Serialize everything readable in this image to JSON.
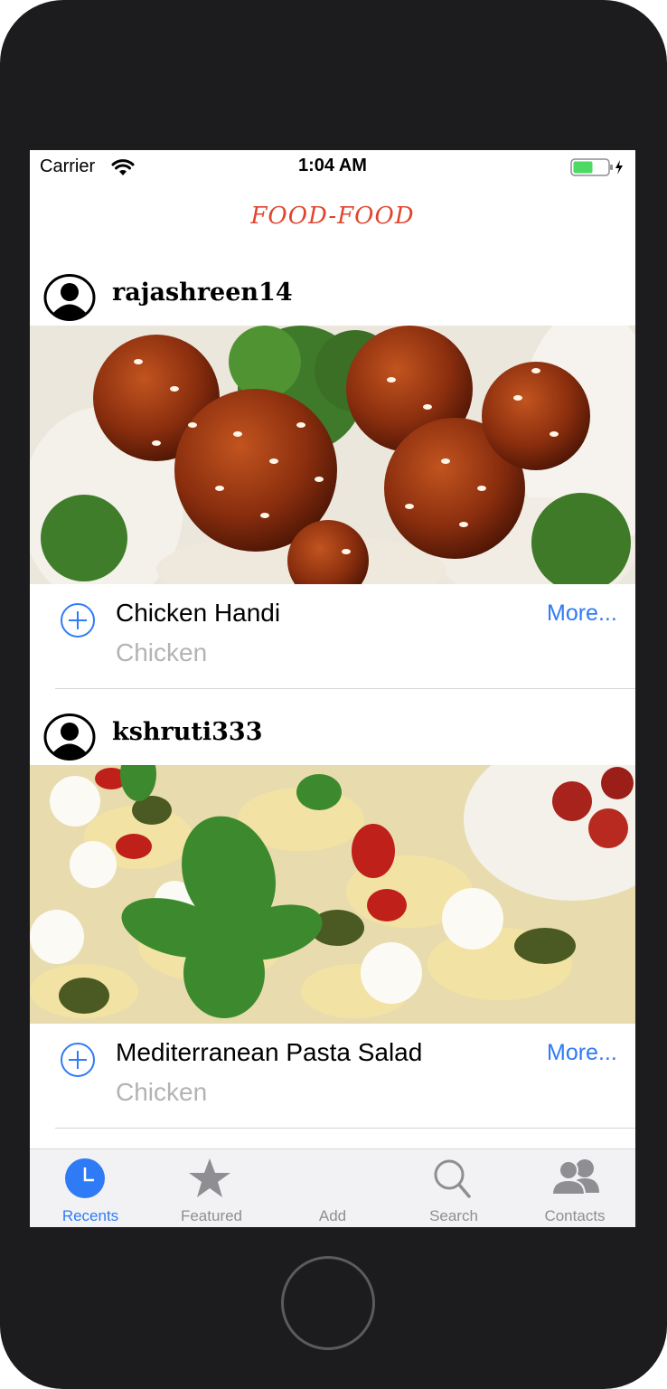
{
  "status_bar": {
    "carrier": "Carrier",
    "time": "1:04 AM"
  },
  "nav": {
    "title": "FOOD-FOOD"
  },
  "posts": [
    {
      "username": "rajashreen14",
      "title": "Chicken Handi",
      "category": "Chicken",
      "more_label": "More..."
    },
    {
      "username": "kshruti333",
      "title": "Mediterranean Pasta Salad",
      "category": "Chicken",
      "more_label": "More..."
    }
  ],
  "tab_bar": {
    "selected": "Recents",
    "items": [
      {
        "label": "Recents",
        "icon": "clock-icon"
      },
      {
        "label": "Featured",
        "icon": "star-icon"
      },
      {
        "label": "Add",
        "icon": "none"
      },
      {
        "label": "Search",
        "icon": "search-icon"
      },
      {
        "label": "Contacts",
        "icon": "contacts-icon"
      }
    ]
  },
  "colors": {
    "accent": "#2f7bf5",
    "title_red": "#e0452d",
    "tab_inactive": "#8e8e93",
    "battery_green": "#4cd964"
  }
}
